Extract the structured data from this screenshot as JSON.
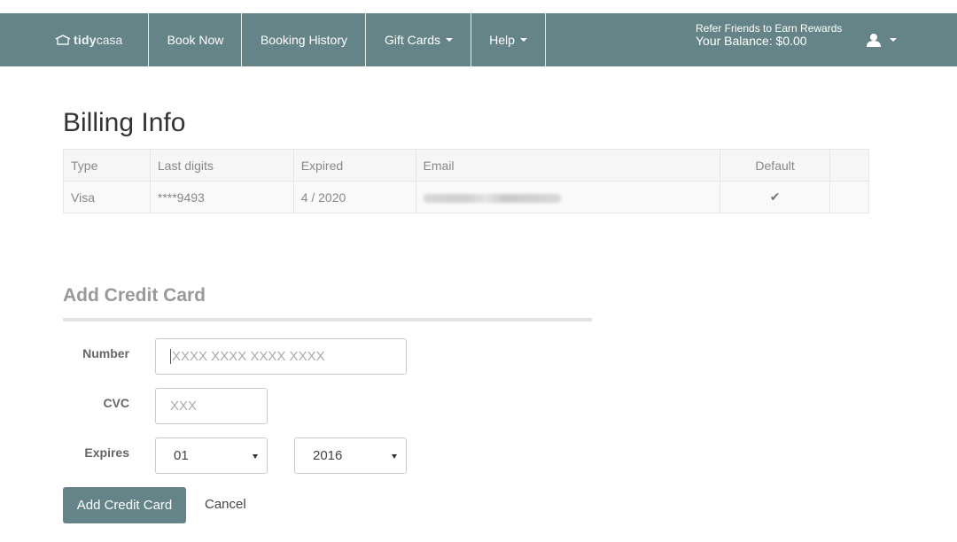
{
  "brand": {
    "part1": "tidy",
    "part2": "casa",
    "icon": "house-icon"
  },
  "nav": {
    "book_now": "Book Now",
    "booking_history": "Booking History",
    "gift_cards": "Gift Cards",
    "help": "Help"
  },
  "rewards": {
    "refer": "Refer Friends to Earn Rewards",
    "balance": "Your Balance: $0.00"
  },
  "user_menu": {
    "icon": "user-icon"
  },
  "page_title": "Billing Info",
  "table": {
    "headers": {
      "type": "Type",
      "last_digits": "Last digits",
      "expired": "Expired",
      "email": "Email",
      "default": "Default"
    },
    "row": {
      "type": "Visa",
      "last_digits": "****9493",
      "expired": "4 / 2020",
      "default": "✔"
    }
  },
  "add_card": {
    "title": "Add Credit Card",
    "number_label": "Number",
    "number_placeholder": "XXXX XXXX XXXX XXXX",
    "cvc_label": "CVC",
    "cvc_placeholder": "XXX",
    "expires_label": "Expires",
    "month_value": "01",
    "year_value": "2016",
    "submit_label": "Add Credit Card",
    "cancel_label": "Cancel"
  },
  "colors": {
    "navbar": "#658487",
    "button": "#658487"
  }
}
